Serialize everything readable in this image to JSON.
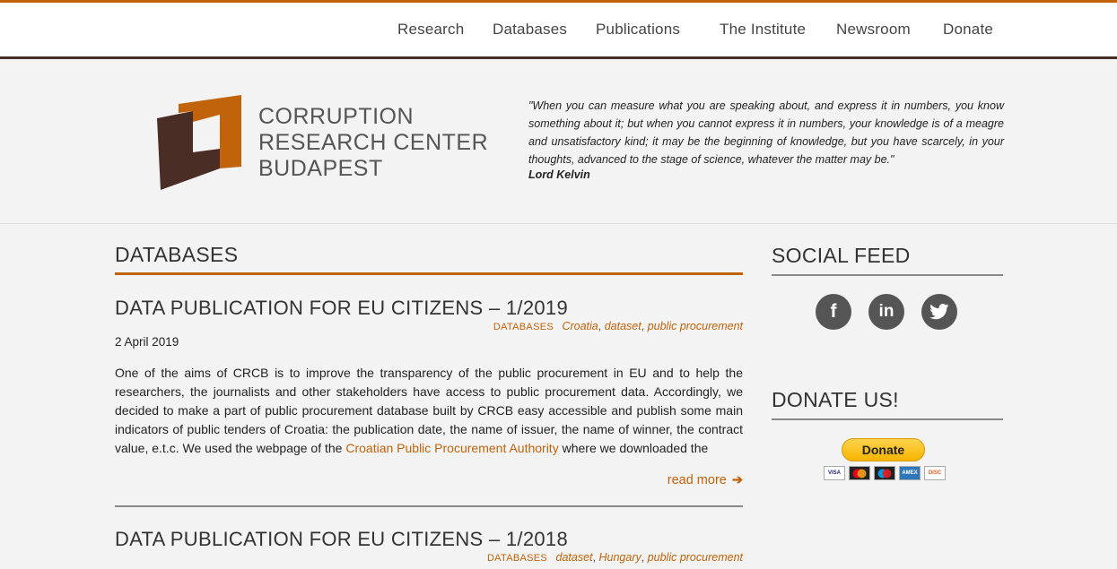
{
  "nav": {
    "items": [
      {
        "label": "Research"
      },
      {
        "label": "Databases"
      },
      {
        "label": "Publications"
      },
      {
        "label": "The Institute"
      },
      {
        "label": "Newsroom"
      },
      {
        "label": "Donate"
      }
    ]
  },
  "header": {
    "logo_lines": [
      "CORRUPTION",
      "RESEARCH CENTER",
      "BUDAPEST"
    ],
    "quote": "\"When you can measure what you are speaking about, and express it in numbers, you know something about it; but when you cannot express it in numbers, your knowledge is of a meagre and unsatisfactory kind; it may be the beginning of knowledge, but you have scarcely, in your thoughts, advanced to the stage of science, whatever the matter may be.\"",
    "quote_author": "Lord Kelvin"
  },
  "main": {
    "section_title": "DATABASES",
    "posts": [
      {
        "title": "DATA PUBLICATION FOR EU CITIZENS – 1/2019",
        "category": "DATABASES",
        "tags": [
          "Croatia",
          "dataset",
          "public procurement"
        ],
        "date": "2 April 2019",
        "body_before_link": "One of the aims of CRCB is to improve the transparency of the public procurement in EU and to help the researchers, the journalists and other stakeholders have access to public procurement data. Accordingly, we decided to make a part of public procurement database built by CRCB easy accessible and publish some main indicators of public tenders of Croatia: the publication date, the name of issuer, the name of winner, the contract value, e.t.c. We used the webpage of the ",
        "body_link": "Croatian Public Procurement Authority",
        "body_after_link": " where we downloaded the",
        "read_more": "read more"
      },
      {
        "title": "DATA PUBLICATION FOR EU CITIZENS – 1/2018",
        "category": "DATABASES",
        "tags": [
          "dataset",
          "Hungary",
          "public procurement"
        ]
      }
    ]
  },
  "sidebar": {
    "social_title": "SOCIAL FEED",
    "social_icons": [
      "f",
      "in",
      "t"
    ],
    "donate_title": "DONATE US!",
    "donate_label": "Donate",
    "cards": [
      "VISA",
      "MC",
      "MAE",
      "AMEX",
      "DISC"
    ]
  },
  "colors": {
    "accent": "#c0630b",
    "dark_brown": "#4a2d25",
    "icon_grey": "#555555"
  }
}
